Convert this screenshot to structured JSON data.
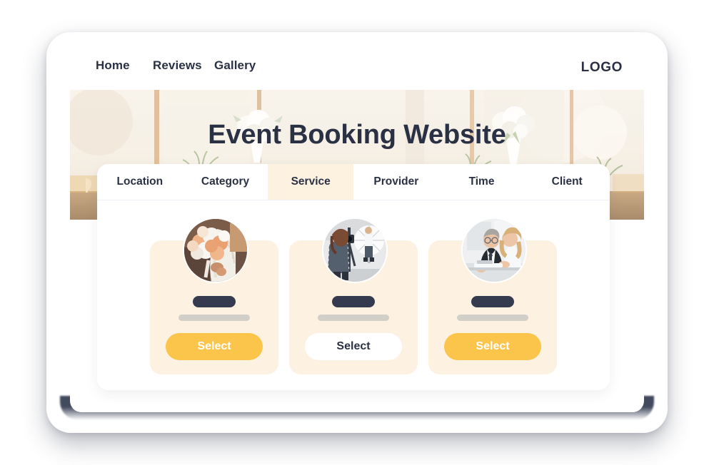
{
  "brand": {
    "logo_text": "LOGO"
  },
  "nav": {
    "items": [
      {
        "label": "Home"
      },
      {
        "label": "Reviews"
      },
      {
        "label": "Gallery"
      }
    ]
  },
  "hero": {
    "title": "Event Booking Website",
    "image_alt": "wedding-venue-photo"
  },
  "tabs": [
    {
      "label": "Location",
      "active": false
    },
    {
      "label": "Category",
      "active": false
    },
    {
      "label": "Service",
      "active": true
    },
    {
      "label": "Provider",
      "active": false
    },
    {
      "label": "Time",
      "active": false
    },
    {
      "label": "Client",
      "active": false
    }
  ],
  "cards": [
    {
      "avatar_alt": "bride-with-bouquet-photo",
      "title_placeholder": "",
      "subtitle_placeholder": "",
      "button_label": "Select",
      "selected": true
    },
    {
      "avatar_alt": "photographer-studio-shoot-photo",
      "title_placeholder": "",
      "subtitle_placeholder": "",
      "button_label": "Select",
      "selected": false
    },
    {
      "avatar_alt": "business-consultation-photo",
      "title_placeholder": "",
      "subtitle_placeholder": "",
      "button_label": "Select",
      "selected": true
    }
  ],
  "colors": {
    "accent_yellow": "#fbc54b",
    "card_cream": "#fdf2e1",
    "tab_active_cream": "#fdf2e0",
    "ink_navy": "#2b3144",
    "placeholder_dark": "#343b4f",
    "placeholder_grey": "#d2cec8",
    "page_background": "#ffffff"
  }
}
